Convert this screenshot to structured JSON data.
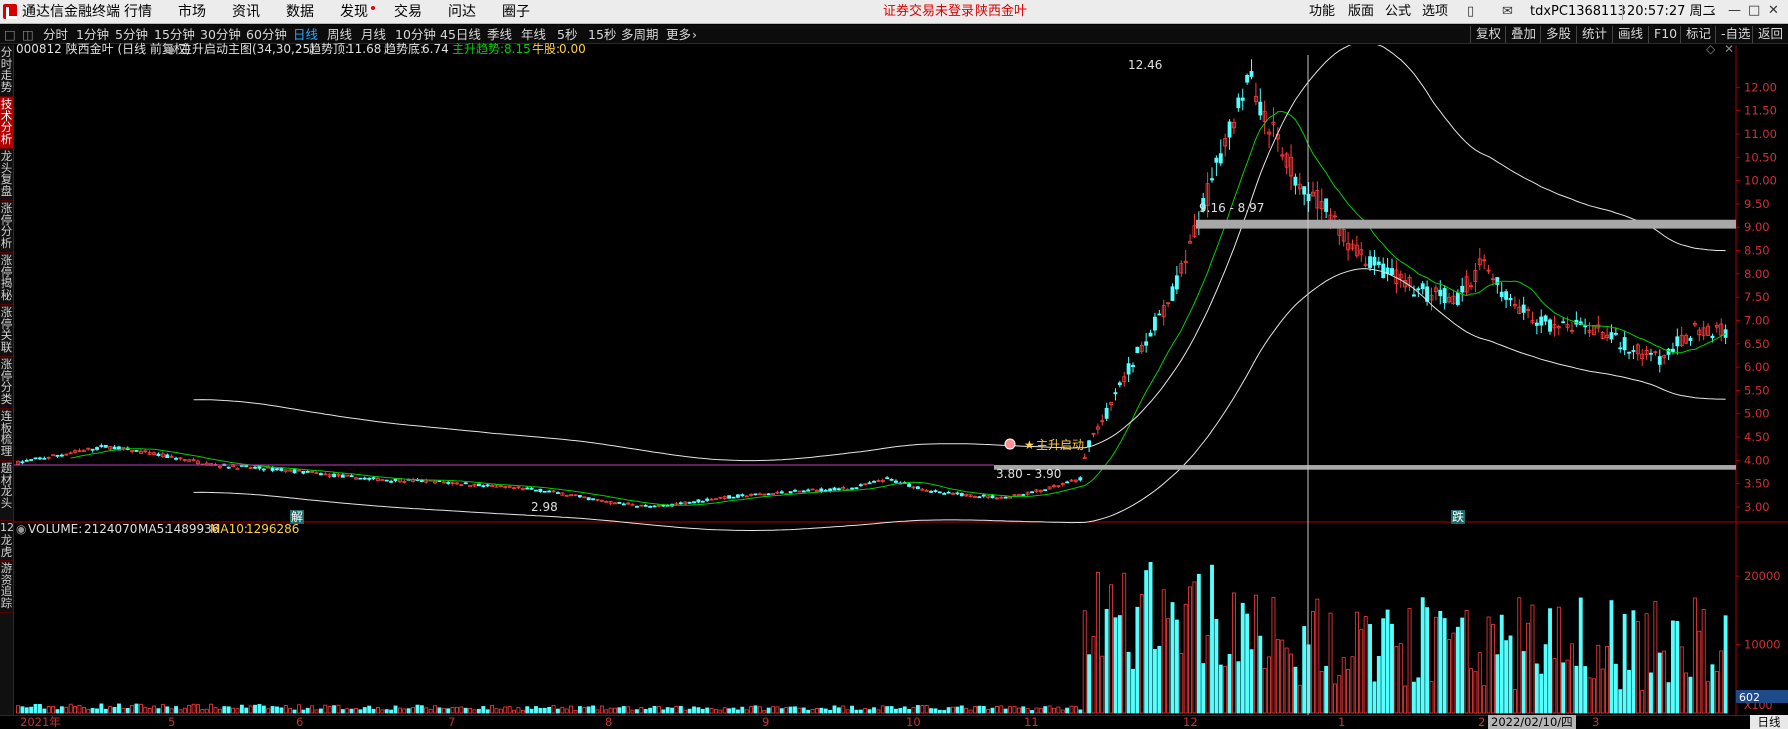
{
  "menubar": {
    "app_title": "通达信金融终端",
    "menus": [
      "行情",
      "市场",
      "资讯",
      "数据",
      "发现",
      "交易",
      "问达",
      "圈子"
    ],
    "notice": "证券交易未登录",
    "stock_name": "陕西金叶",
    "right_menus": [
      "功能",
      "版面",
      "公式",
      "选项"
    ],
    "user_id": "tdxPC1368113",
    "clock": "20:57:27 周二"
  },
  "toolbar": {
    "periods": [
      "分时",
      "1分钟",
      "5分钟",
      "15分钟",
      "30分钟",
      "60分钟",
      "日线",
      "周线",
      "月线",
      "10分钟",
      "45日线",
      "季线",
      "年线",
      "5秒",
      "15秒",
      "多周期",
      "更多"
    ],
    "active_period": "日线",
    "right_buttons": [
      "复权",
      "叠加",
      "多股",
      "统计",
      "画线",
      "F10",
      "标记",
      "-自选",
      "返回"
    ]
  },
  "sidetabs": [
    {
      "label": "分时走势",
      "active": false
    },
    {
      "label": "技术分析",
      "active": true
    },
    {
      "label": "龙头复盘",
      "active": false
    },
    {
      "label": "涨停分析",
      "active": false
    },
    {
      "label": "涨停揭秘",
      "active": false
    },
    {
      "label": "涨停关联",
      "active": false
    },
    {
      "label": "涨停分类",
      "active": false
    },
    {
      "label": "连板梳理",
      "active": false
    },
    {
      "label": "题材龙头",
      "active": false
    },
    {
      "label": "龙虎",
      "active": false
    },
    {
      "label": "游资追踪",
      "active": false
    }
  ],
  "chart": {
    "header": {
      "code_name": "000812 陕西金叶 (日线 前复权)",
      "indicator": "主升启动主图(34,30,25)",
      "trend_top_label": "趋势顶:",
      "trend_top_value": "11.68",
      "trend_bottom_label": "趋势底:",
      "trend_bottom_value": "6.74",
      "main_trend_label": "主升趋势:",
      "main_trend_value": "8.15",
      "bull_label": "牛股:",
      "bull_value": "0.00"
    },
    "annotations": {
      "high": "12.46",
      "low": "2.98",
      "resistance": "9.16 - 8.97",
      "support": "3.80 - 3.90",
      "launch": "主升启动",
      "unlock_tag": "解",
      "fall_tag": "跌"
    },
    "price_ticks": [
      "12.00",
      "11.50",
      "11.00",
      "10.50",
      "10.00",
      "9.50",
      "9.00",
      "8.50",
      "8.00",
      "7.50",
      "7.00",
      "6.50",
      "6.00",
      "5.50",
      "5.00",
      "4.50",
      "4.00",
      "3.50",
      "3.00"
    ],
    "volume_header": {
      "volume_label": "VOLUME:",
      "volume_value": "2124070",
      "ma5_label": "MA5:",
      "ma5_value": "1489936",
      "ma10_label": "MA10:",
      "ma10_value": "1296286"
    },
    "volume_ticks": [
      "20000",
      "10000"
    ],
    "volume_unit": "X100",
    "volume_last_label": "602",
    "side_numbers": [
      "12"
    ],
    "colors": {
      "up": "#ff3c3c",
      "down": "#54ffff",
      "ma_white": "#e6e6e6",
      "ma_green": "#00d000",
      "ma_yellow": "#ffd040",
      "axis": "#b00000"
    }
  },
  "bottombar": {
    "year_label": "2021年",
    "months": [
      "5",
      "6",
      "7",
      "8",
      "9",
      "10",
      "11",
      "12",
      "1",
      "2",
      "3"
    ],
    "current_date": "2022/02/10/四",
    "period": "日线"
  }
}
